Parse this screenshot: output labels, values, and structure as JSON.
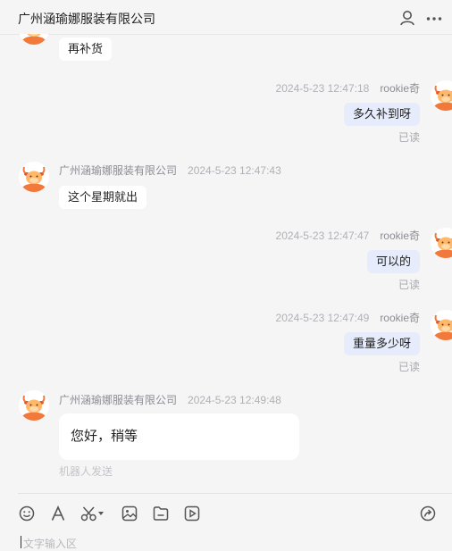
{
  "header": {
    "title": "广州涵瑜娜服装有限公司",
    "icons": [
      "contact-person-icon",
      "more-icon"
    ]
  },
  "messages": [
    {
      "direction": "in",
      "text": "再补货"
    },
    {
      "direction": "out",
      "sender": "rookie奇",
      "time": "2024-5-23 12:47:18",
      "text": "多久补到呀",
      "status": "已读"
    },
    {
      "direction": "in",
      "sender": "广州涵瑜娜服装有限公司",
      "time": "2024-5-23 12:47:43",
      "text": "这个星期就出"
    },
    {
      "direction": "out",
      "sender": "rookie奇",
      "time": "2024-5-23 12:47:47",
      "text": "可以的",
      "status": "已读"
    },
    {
      "direction": "out",
      "sender": "rookie奇",
      "time": "2024-5-23 12:47:49",
      "text": "重量多少呀",
      "status": "已读"
    },
    {
      "direction": "in",
      "sender": "广州涵瑜娜服装有限公司",
      "time": "2024-5-23 12:49:48",
      "text": "您好，稍等",
      "note": "机器人发送"
    }
  ],
  "toolbar": {
    "icons": [
      "emoji-icon",
      "font-icon",
      "scissors-icon",
      "image-icon",
      "file-icon",
      "video-icon",
      "share-icon"
    ]
  },
  "input": {
    "placeholder": "文字输入区"
  },
  "colors": {
    "outgoing_bubble": "#e6ecfb",
    "incoming_bubble": "#ffffff",
    "avatar_orange": "#f0793b",
    "background": "#f5f5f6"
  }
}
